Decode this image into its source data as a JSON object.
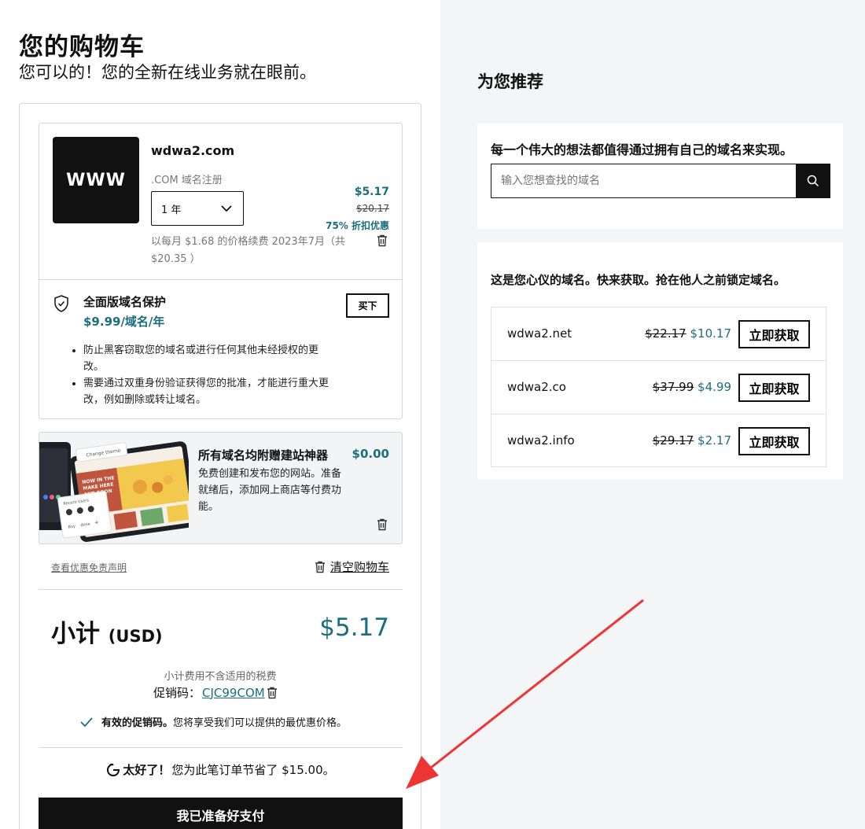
{
  "header": {
    "title": "您的购物车",
    "subtitle": "您可以的！您的全新在线业务就在眼前。"
  },
  "cart_item": {
    "tile_text": "WWW",
    "domain": "wdwa2.com",
    "type": ".COM 域名注册",
    "term": "1 年",
    "price": "$5.17",
    "old_price": "$20.17",
    "discount": "75% 折扣优惠",
    "renewal": "以每月 $1.68 的价格续费 2023年7月（共 $20.35 ）"
  },
  "protection": {
    "title": "全面版域名保护",
    "price": "$9.99/域名/年",
    "buy_label": "买下",
    "bullets": [
      "防止黑客窃取您的域名或进行任何其他未经授权的更改。",
      "需要通过双重身份验证获得您的批准，才能进行重大更改，例如删除或转让域名。"
    ]
  },
  "builder": {
    "title": "所有域名均附赠建站神器",
    "price": "$0.00",
    "description": "免费创建和发布您的网站。准备就绪后，添加网上商店等付费功能。",
    "image_text": {
      "change_theme": "Change theme",
      "hero": "NOW IN THE MAKE HERE AND SOON",
      "recent_users": "Recent Users",
      "buy": "Buy",
      "done": "done"
    }
  },
  "links": {
    "disclaimer": "查看优惠免责声明",
    "clear_cart": "清空购物车"
  },
  "summary": {
    "subtotal_label": "小计",
    "currency": "(USD)",
    "subtotal_value": "$5.17",
    "tax_note": "小计费用不含适用的税费",
    "promo_label": "促销码：",
    "promo_code": "CJC99COM",
    "valid_bold": "有效的促销码。",
    "valid_text": "您将享受我们可以提供的最优惠价格。",
    "save_bold": "太好了！",
    "save_text": "您为此笔订单节省了 $15.00。",
    "pay_button": "我已准备好支付"
  },
  "recommendations": {
    "title": "为您推荐",
    "search_heading": "每一个伟大的想法都值得通过拥有自己的域名来实现。",
    "search_placeholder": "输入您想查找的域名",
    "suggest_heading": "这是您心仪的域名。快来获取。抢在他人之前锁定域名。",
    "get_label": "立即获取",
    "items": [
      {
        "domain": "wdwa2.net",
        "old_price": "$22.17",
        "price": "$10.17"
      },
      {
        "domain": "wdwa2.co",
        "old_price": "$37.99",
        "price": "$4.99"
      },
      {
        "domain": "wdwa2.info",
        "old_price": "$29.17",
        "price": "$2.17"
      }
    ]
  },
  "colors": {
    "accent": "#1b6e7d",
    "annotation_arrow": "#ee3535",
    "dark": "#111111",
    "right_panel_bg": "#f4f5f6"
  }
}
